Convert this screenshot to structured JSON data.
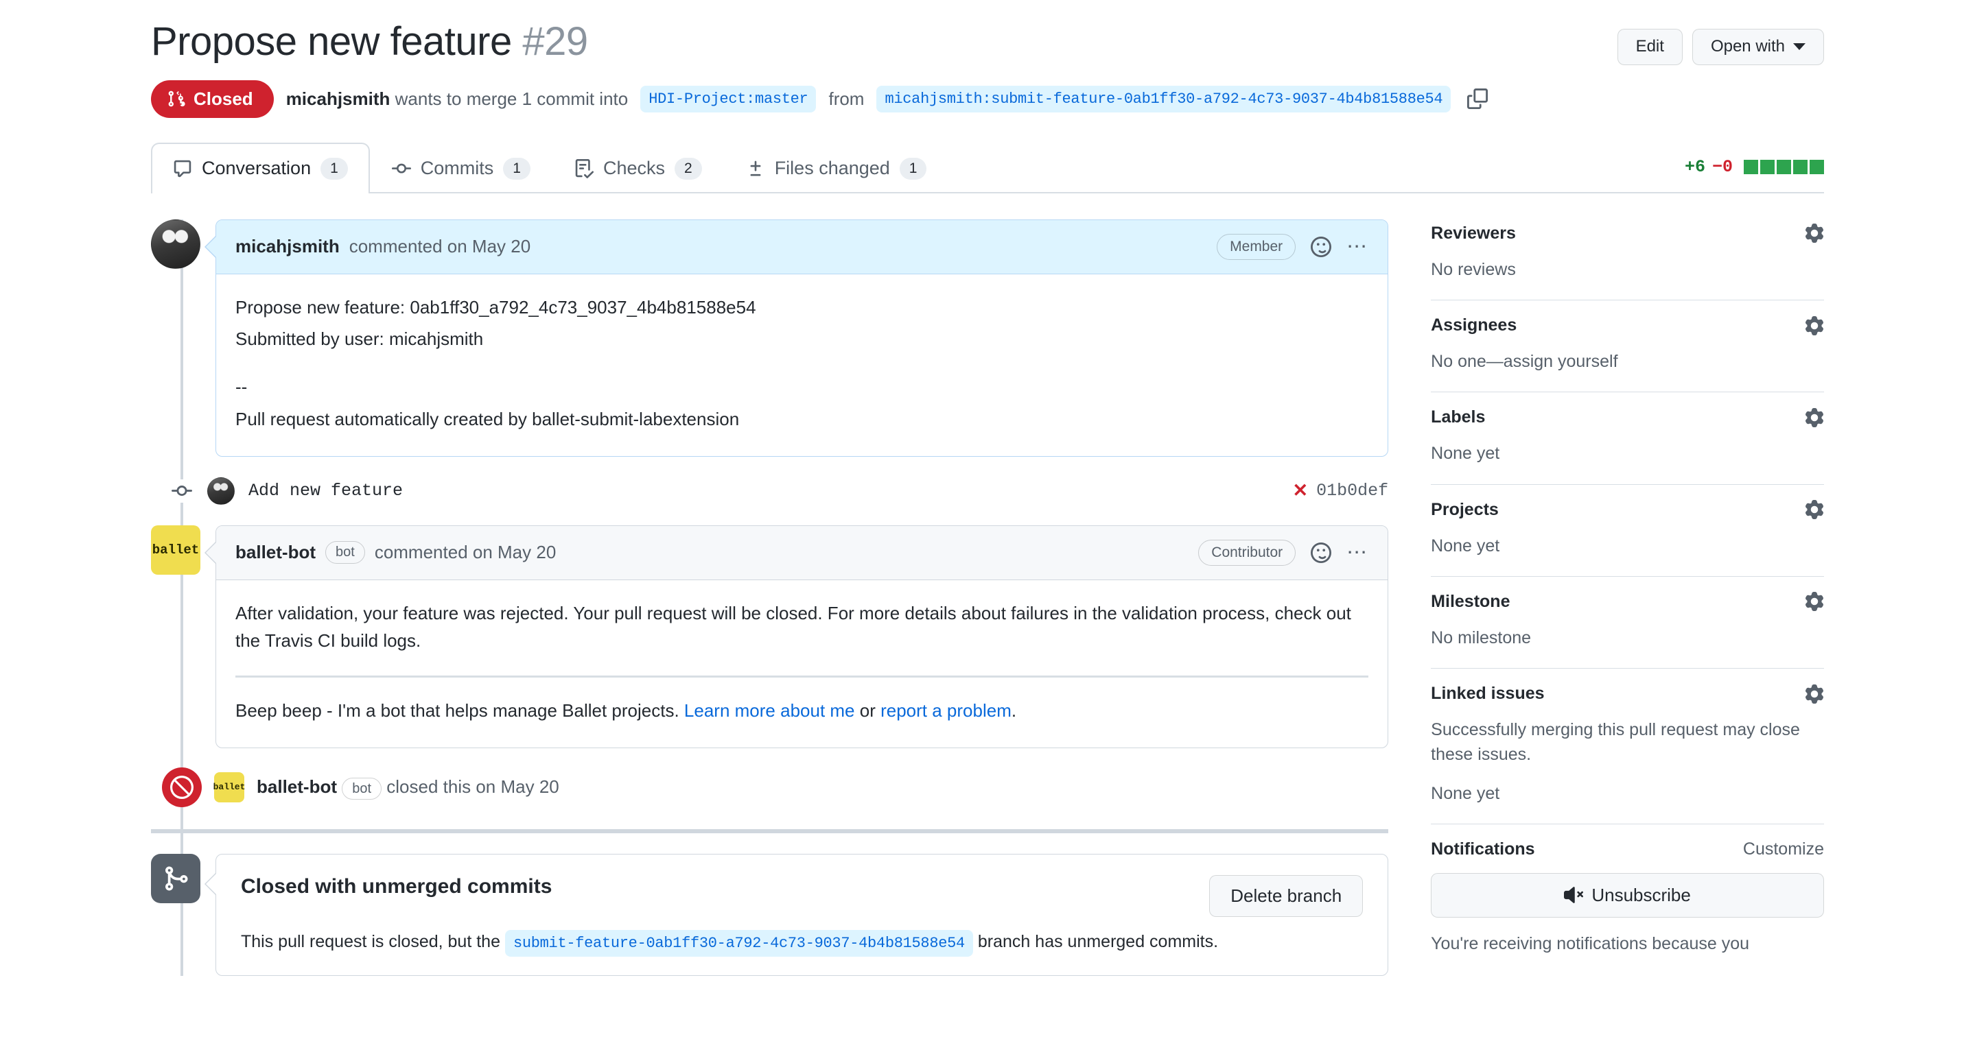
{
  "header": {
    "title": "Propose new feature",
    "number": "#29",
    "edit_label": "Edit",
    "open_with_label": "Open with",
    "state": "Closed",
    "meta_author": "micahjsmith",
    "meta_text_1": "wants to merge 1 commit into",
    "base_branch": "HDI-Project:master",
    "meta_text_2": "from",
    "head_branch": "micahjsmith:submit-feature-0ab1ff30-a792-4c73-9037-4b4b81588e54"
  },
  "tabs": [
    {
      "label": "Conversation",
      "count": "1",
      "icon": "comment-icon",
      "active": true
    },
    {
      "label": "Commits",
      "count": "1",
      "icon": "commit-icon",
      "active": false
    },
    {
      "label": "Checks",
      "count": "2",
      "icon": "checklist-icon",
      "active": false
    },
    {
      "label": "Files changed",
      "count": "1",
      "icon": "diff-icon",
      "active": false
    }
  ],
  "diffstat": {
    "additions": "+6",
    "deletions": "−0",
    "blocks": 5,
    "add_color": "#1a7f37",
    "del_color": "#cf222e",
    "block_color": "#2da44e"
  },
  "comments": [
    {
      "author": "micahjsmith",
      "meta": "commented on May 20",
      "role": "Member",
      "avatar": "user-photo",
      "lines": [
        "Propose new feature: 0ab1ff30_a792_4c73_9037_4b4b81588e54",
        "Submitted by user: micahjsmith",
        "--",
        "Pull request automatically created by ballet-submit-labextension"
      ]
    }
  ],
  "commit_event": {
    "message": "Add new feature",
    "status_icon": "x-mark",
    "sha": "01b0def"
  },
  "bot_comment": {
    "author": "ballet-bot",
    "bot_badge": "bot",
    "meta": "commented on May 20",
    "role": "Contributor",
    "avatar_text": "ballet",
    "paragraph": "After validation, your feature was rejected. Your pull request will be closed. For more details about failures in the validation process, check out the Travis CI build logs.",
    "footer_prefix": "Beep beep - I'm a bot that helps manage Ballet projects. ",
    "footer_link_1": "Learn more about me",
    "footer_mid": " or ",
    "footer_link_2": "report a problem",
    "footer_suffix": "."
  },
  "closed_event": {
    "avatar_text": "ballet",
    "actor": "ballet-bot",
    "bot_badge": "bot",
    "text": "closed this on May 20"
  },
  "merge_box": {
    "title": "Closed with unmerged commits",
    "desc_prefix": "This pull request is closed, but the ",
    "desc_branch": "submit-feature-0ab1ff30-a792-4c73-9037-4b4b81588e54",
    "desc_suffix": " branch has unmerged commits.",
    "delete_label": "Delete branch"
  },
  "sidebar": [
    {
      "title": "Reviewers",
      "value": "No reviews",
      "gear": "gear-icon"
    },
    {
      "title": "Assignees",
      "value": "No one—assign yourself",
      "gear": "gear-icon"
    },
    {
      "title": "Labels",
      "value": "None yet",
      "gear": "gear-icon"
    },
    {
      "title": "Projects",
      "value": "None yet",
      "gear": "gear-icon"
    },
    {
      "title": "Milestone",
      "value": "No milestone",
      "gear": "gear-icon"
    },
    {
      "title": "Linked issues",
      "value": "Successfully merging this pull request may close these issues.",
      "value2": "None yet",
      "gear": "gear-icon"
    }
  ],
  "notifications": {
    "title": "Notifications",
    "customize": "Customize",
    "button_label": "Unsubscribe",
    "note": "You're receiving notifications because you"
  },
  "colors": {
    "closed_red": "#cf222e",
    "link_blue": "#0969da",
    "branch_bg": "#ddf4ff",
    "ballet_yellow": "#f0dd4f"
  }
}
